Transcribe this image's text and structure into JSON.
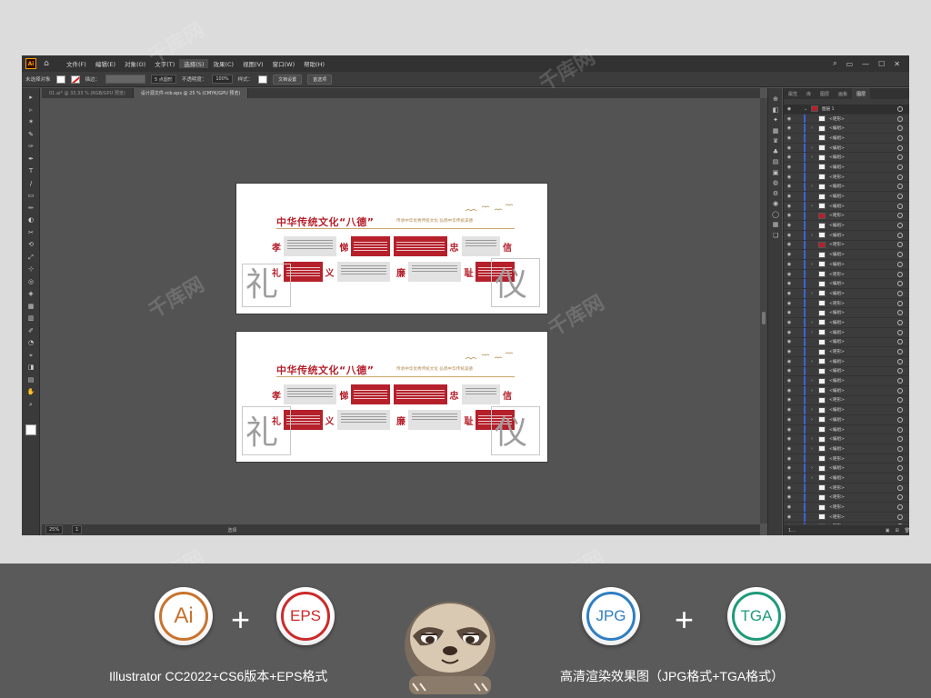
{
  "app": {
    "logo": "Ai",
    "menu": [
      "文件(F)",
      "编辑(E)",
      "对象(O)",
      "文字(T)",
      "选择(S)",
      "效果(C)",
      "视图(V)",
      "窗口(W)",
      "帮助(H)"
    ],
    "active_menu_index": 4
  },
  "controlbar": {
    "selection_label": "未选择对象",
    "stroke_label": "描边：",
    "brush_label": "5 点圆形",
    "opacity_label": "不透明度：",
    "opacity_value": "100%",
    "style_label": "样式：",
    "doc_setup": "文档设置",
    "prefs": "首选项"
  },
  "tabs": [
    {
      "label": "01.ai* @ 33.33 % (RGB/GPU 预览)",
      "active": false
    },
    {
      "label": "设计源文件-rcb.eps @ 25 % (CMYK/GPU 预览)",
      "active": true
    }
  ],
  "status": {
    "zoom": "25%",
    "page": "1",
    "tool": "选择"
  },
  "artboards": [
    {
      "title": "中华传统文化“八德”",
      "subtitle": "传承中华优秀传统文化  弘扬中华传统美德",
      "chars_top": [
        "孝",
        "悌",
        "忠",
        "信"
      ],
      "chars_bottom": [
        "礼",
        "义",
        "廉",
        "耻"
      ],
      "left_char": "礼",
      "right_char": "仪"
    },
    {
      "title": "中华传统文化“八德”",
      "subtitle": "传承中华优秀传统文化  弘扬中华传统美德",
      "chars_top": [
        "孝",
        "悌",
        "忠",
        "信"
      ],
      "chars_bottom": [
        "礼",
        "义",
        "廉",
        "耻"
      ],
      "left_char": "礼",
      "right_char": "仪"
    }
  ],
  "layers": {
    "tabs": [
      "属性",
      "库",
      "图层",
      "画板",
      "图层"
    ],
    "active_tab_index": 4,
    "top_layer": "图层 1",
    "rows": [
      "<矩形>",
      "<编组>",
      "<编组>",
      "<编组>",
      "<编组>",
      "<编组>",
      "<矩形>",
      "<编组>",
      "<编组>",
      "<编组>",
      "<矩形>",
      "<编组>",
      "<编组>",
      "<矩形>",
      "<编组>",
      "<编组>",
      "<矩形>",
      "<编组>",
      "<编组>",
      "<矩形>",
      "<编组>",
      "<编组>",
      "<编组>",
      "<编组>",
      "<矩形>",
      "<编组>",
      "<编组>",
      "<编组>",
      "<编组>",
      "<矩形>",
      "<编组>",
      "<编组>",
      "<编组>",
      "<编组>",
      "<编组>",
      "<矩形>",
      "<编组>",
      "<编组>",
      "<矩形>",
      "<矩形>",
      "<矩形>",
      "<矩形>",
      "<矩形>"
    ],
    "red_thumb_rows": [
      10,
      13
    ],
    "footer": "1..."
  },
  "banner": {
    "badges": [
      {
        "label": "Ai",
        "color": "#c8732e"
      },
      {
        "label": "EPS",
        "color": "#cc2a2a"
      },
      {
        "label": "JPG",
        "color": "#2f7fc4"
      },
      {
        "label": "TGA",
        "color": "#1e9a7a"
      }
    ],
    "plus": "+",
    "caption_left": "Illustrator CC2022+CS6版本+EPS格式",
    "caption_right": "高清渲染效果图（JPG格式+TGA格式）"
  },
  "watermark": "千库网"
}
